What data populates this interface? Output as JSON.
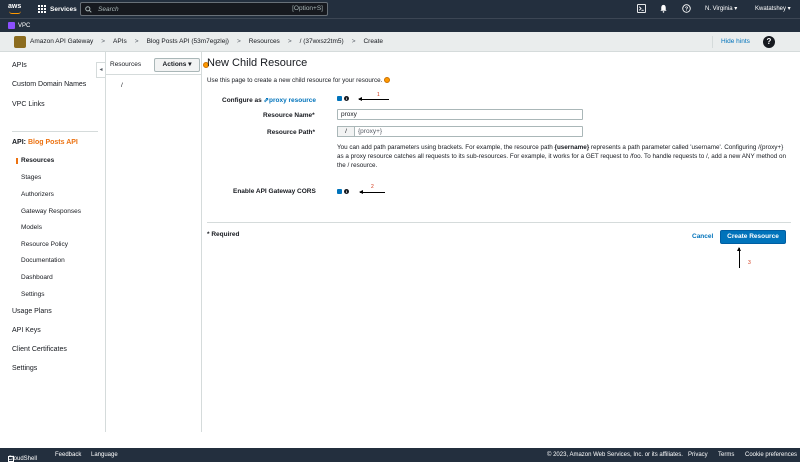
{
  "topbar": {
    "logo_text": "aws",
    "services_label": "Services",
    "search_placeholder": "Search",
    "search_shortcut": "[Option+S]",
    "region_label": "N. Virginia ▾",
    "user_label": "Kwatatshey ▾",
    "icons": [
      "cloudshell-icon",
      "bell-icon",
      "help-circle-icon",
      "gear-icon"
    ]
  },
  "vpcbar": {
    "label": "VPC"
  },
  "breadcrumbs": {
    "service": "Amazon API Gateway",
    "items": [
      "APIs",
      "Blog Posts API (53m7egzlej)",
      "Resources",
      "/ (37wxsz2tm5)",
      "Create"
    ],
    "separator": ">",
    "hide_hints": "Hide hints",
    "help_icon": "?"
  },
  "sidebar": {
    "top_items": [
      "APIs",
      "Custom Domain Names",
      "VPC Links"
    ],
    "api_prefix": "API:",
    "api_name": "Blog Posts API",
    "sub_items": [
      "Resources",
      "Stages",
      "Authorizers",
      "Gateway Responses",
      "Models",
      "Resource Policy",
      "Documentation",
      "Dashboard",
      "Settings"
    ],
    "active_sub_item": "Resources",
    "bottom_items": [
      "Usage Plans",
      "API Keys",
      "Client Certificates",
      "Settings"
    ],
    "collapse_icon": "◂"
  },
  "resources_panel": {
    "label": "Resources",
    "actions_label": "Actions ▾",
    "root_path": "/"
  },
  "main": {
    "title": "New Child Resource",
    "intro": "Use this page to create a new child resource for your resource.",
    "configure_prefix": "Configure as",
    "configure_link": "proxy resource",
    "configure_checked": true,
    "resource_name_label": "Resource Name*",
    "resource_name_value": "proxy",
    "resource_path_label": "Resource Path*",
    "resource_path_prefix": "/",
    "resource_path_value": "{proxy+}",
    "help_text_1": "You can add path parameters using brackets. For example, the resource path ",
    "help_text_bold": "{username}",
    "help_text_2": " represents a path parameter called 'username'. Configuring /{proxy+} as a proxy resource catches all requests to its sub-resources. For example, it works for a GET request to /foo. To handle requests to /, add a new ANY method on the / resource.",
    "cors_label": "Enable API Gateway CORS",
    "cors_checked": true,
    "required_note": "* Required",
    "cancel_label": "Cancel",
    "create_label": "Create Resource",
    "annotations": [
      "1",
      "2",
      "3"
    ]
  },
  "footer": {
    "cloudshell": "CloudShell",
    "feedback": "Feedback",
    "language": "Language",
    "copyright": "© 2023, Amazon Web Services, Inc. or its affiliates.",
    "privacy": "Privacy",
    "terms": "Terms",
    "cookies": "Cookie preferences"
  },
  "colors": {
    "nav_bg": "#232f3e",
    "accent_orange": "#ec7211",
    "link_blue": "#0073bb",
    "primary_button": "#0073bb",
    "annotation_red": "#d13212"
  }
}
